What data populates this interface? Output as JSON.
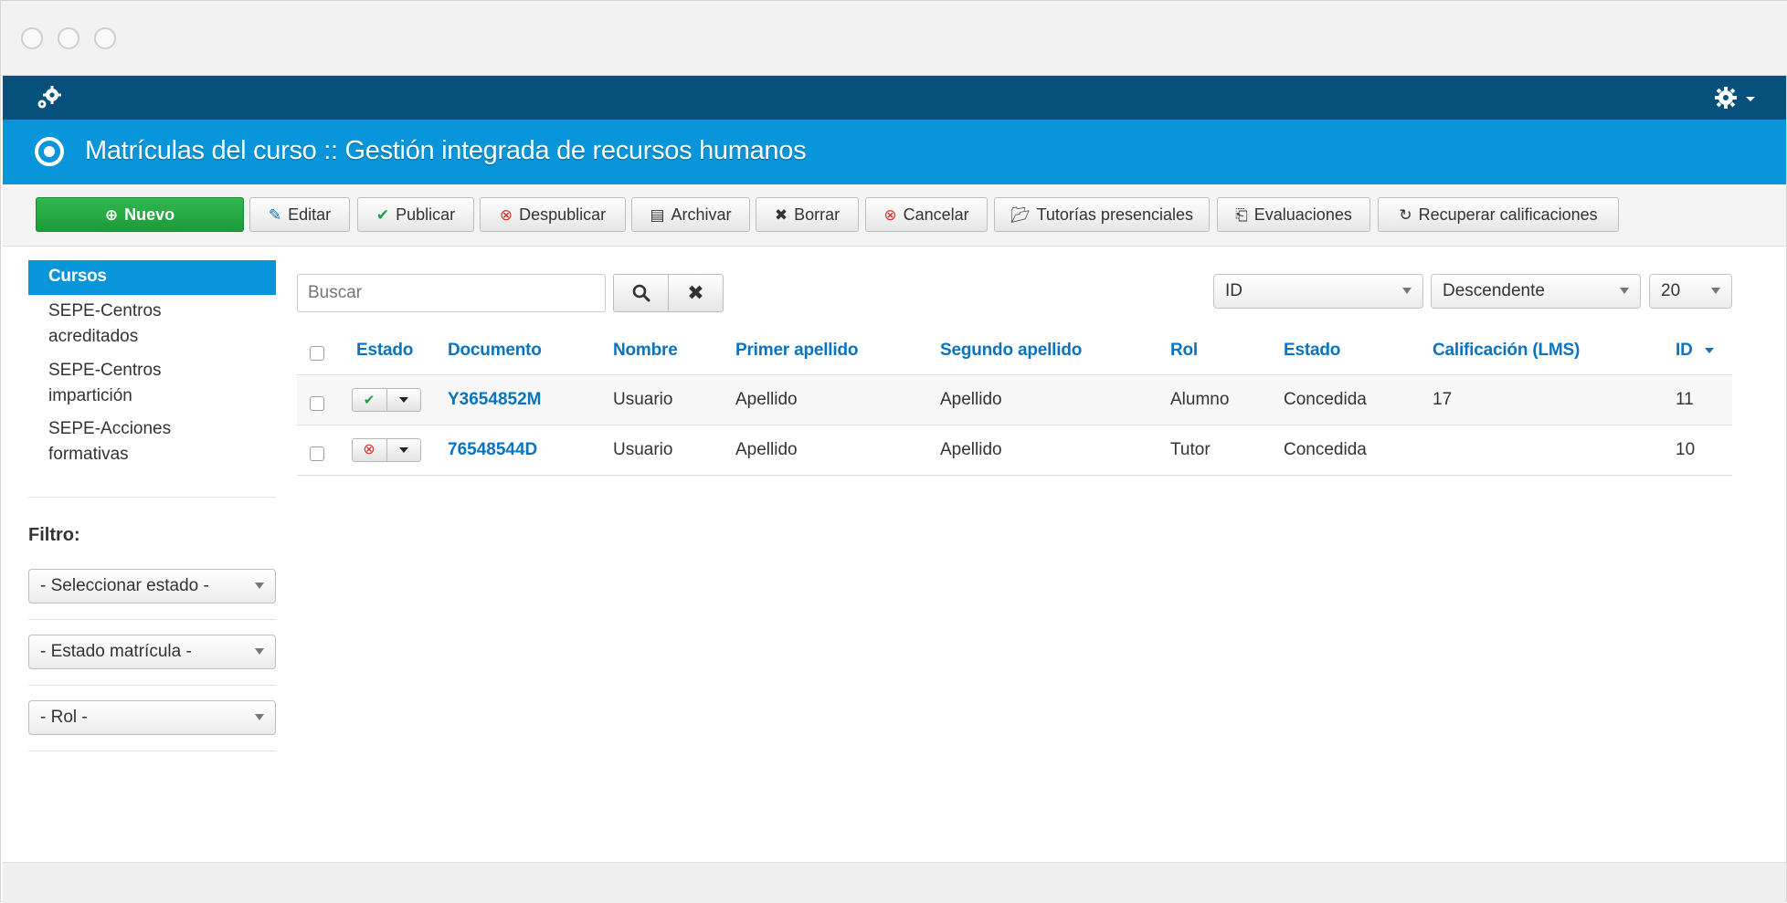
{
  "page": {
    "title": "Matrículas del curso :: Gestión integrada de recursos humanos"
  },
  "colors": {
    "topbar": "#06507c",
    "header": "#0895d9",
    "link": "#0874bf",
    "new_button": "#2fb84f"
  },
  "toolbar": {
    "new_label": "Nuevo",
    "edit_label": "Editar",
    "publish_label": "Publicar",
    "unpublish_label": "Despublicar",
    "archive_label": "Archivar",
    "delete_label": "Borrar",
    "cancel_label": "Cancelar",
    "tutorials_label": "Tutorías presenciales",
    "evaluations_label": "Evaluaciones",
    "recover_label": "Recuperar calificaciones"
  },
  "sidebar": {
    "items": [
      {
        "label": "Cursos",
        "active": true
      },
      {
        "label": "SEPE-Centros acreditados"
      },
      {
        "label": "SEPE-Centros impartición"
      },
      {
        "label": "SEPE-Acciones formativas"
      }
    ],
    "filter_label": "Filtro:",
    "filters": [
      {
        "value": "- Seleccionar estado -"
      },
      {
        "value": "- Estado matrícula -"
      },
      {
        "value": "- Rol -"
      }
    ]
  },
  "search": {
    "placeholder": "Buscar",
    "value": ""
  },
  "sorting": {
    "order_by": "ID",
    "direction": "Descendente",
    "limit": "20"
  },
  "table": {
    "headers": {
      "estado": "Estado",
      "documento": "Documento",
      "nombre": "Nombre",
      "primer_apellido": "Primer apellido",
      "segundo_apellido": "Segundo apellido",
      "rol": "Rol",
      "estado2": "Estado",
      "calificacion": "Calificación (LMS)",
      "id": "ID"
    },
    "rows": [
      {
        "published": true,
        "documento": "Y3654852M",
        "nombre": "Usuario",
        "primer_apellido": "Apellido",
        "segundo_apellido": "Apellido",
        "rol": "Alumno",
        "estado": "Concedida",
        "calificacion": "17",
        "id": "11"
      },
      {
        "published": false,
        "documento": "76548544D",
        "nombre": "Usuario",
        "primer_apellido": "Apellido",
        "segundo_apellido": "Apellido",
        "rol": "Tutor",
        "estado": "Concedida",
        "calificacion": "",
        "id": "10"
      }
    ]
  }
}
